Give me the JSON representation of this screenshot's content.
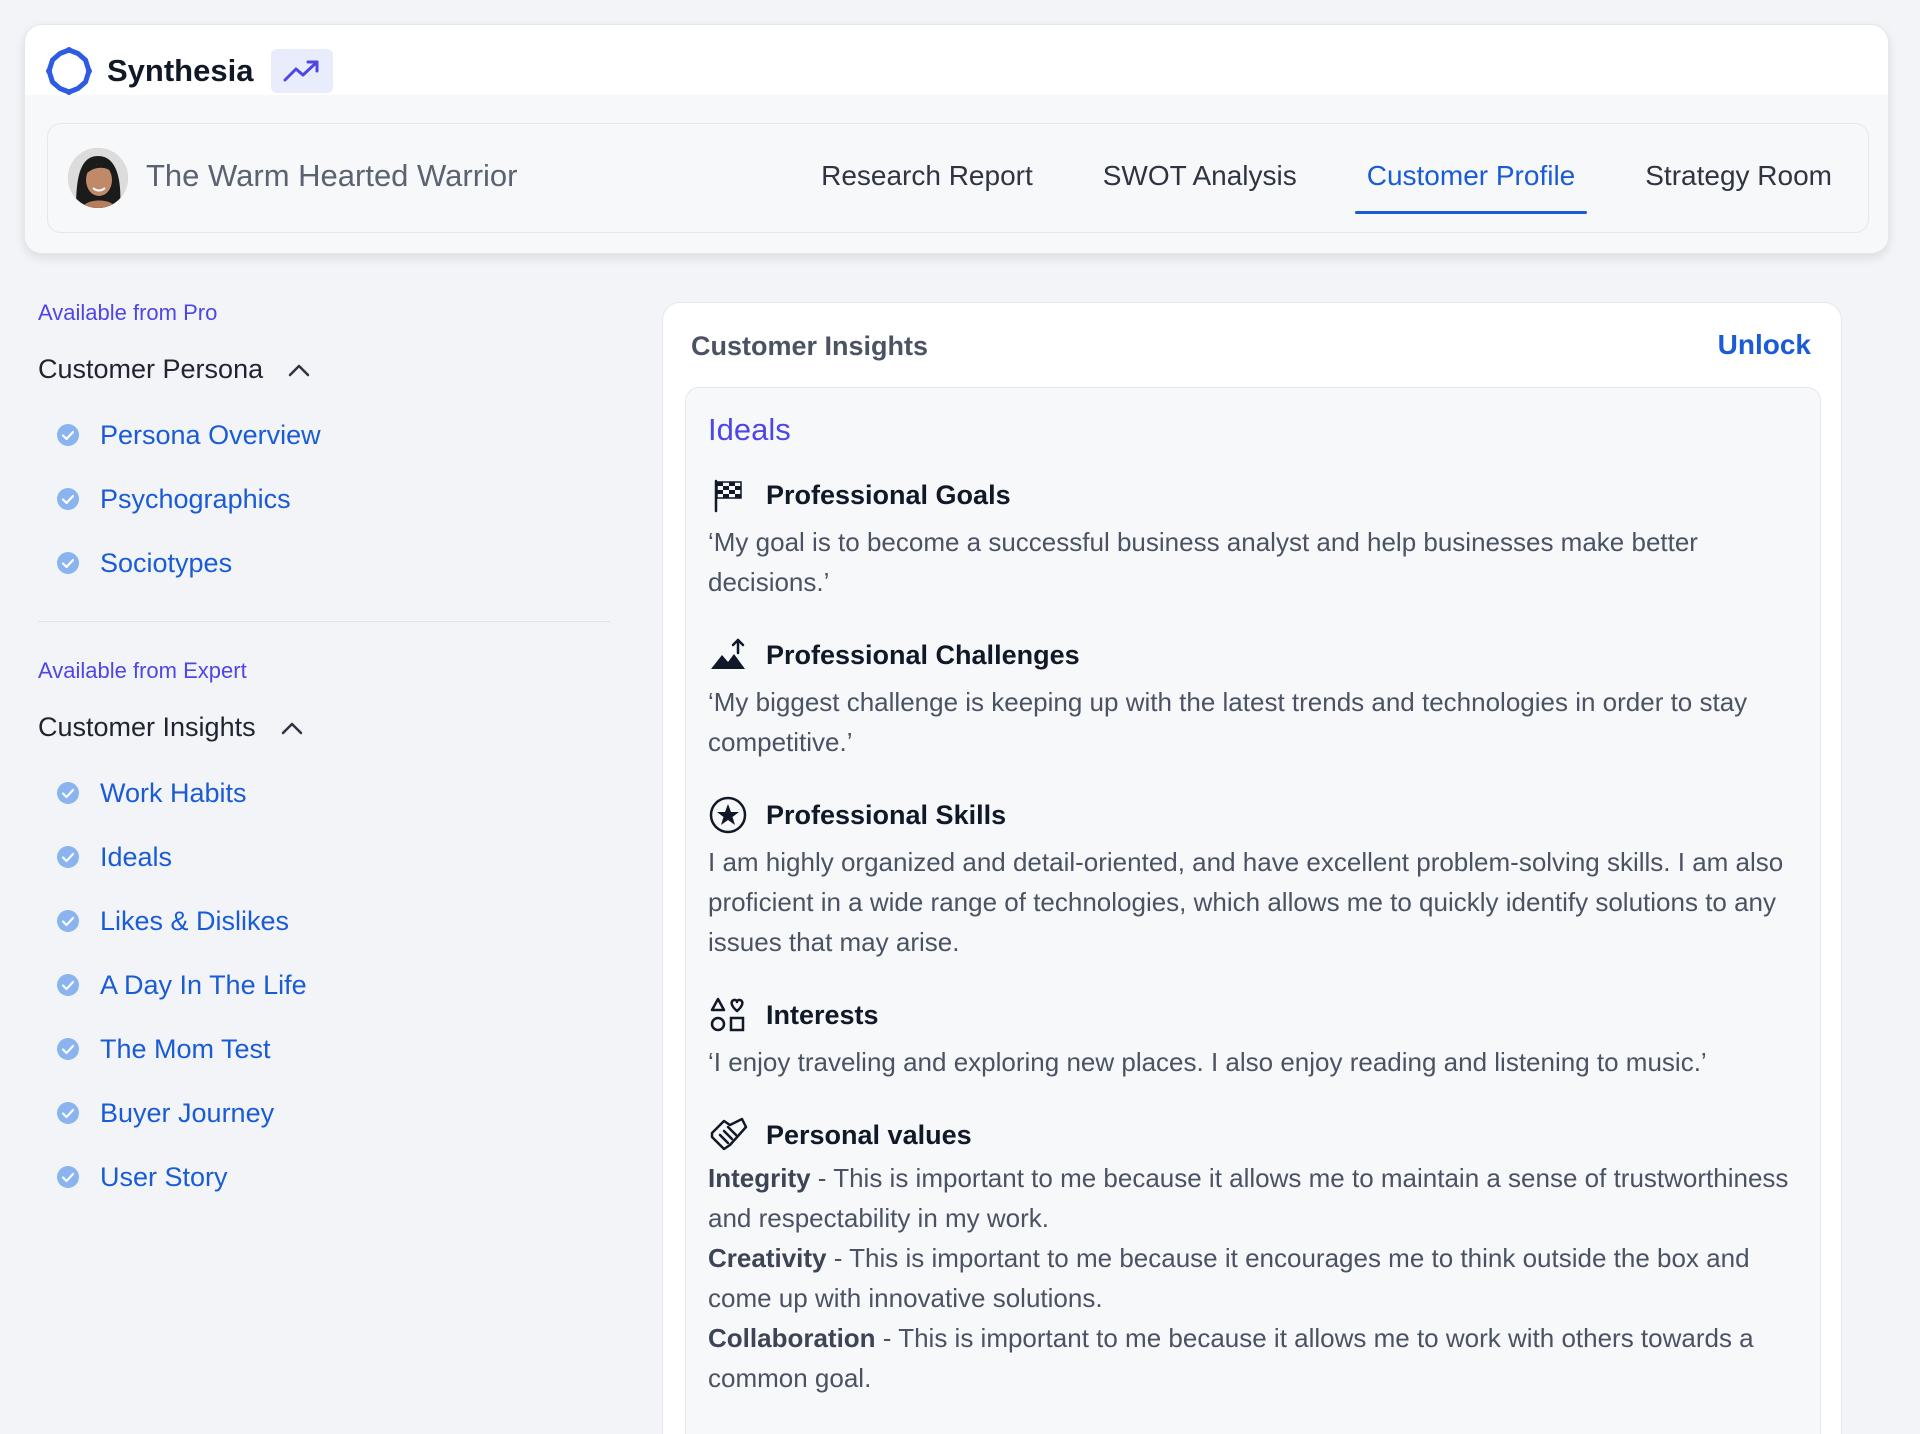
{
  "app": {
    "brand_name": "Synthesia",
    "logo_icon": "synthesia-ring-logo",
    "trend_icon": "trending-up-icon"
  },
  "persona": {
    "name": "The Warm Hearted Warrior",
    "avatar_icon": "avatar"
  },
  "tabs": [
    {
      "label": "Research Report",
      "active": false
    },
    {
      "label": "SWOT Analysis",
      "active": false
    },
    {
      "label": "Customer Profile",
      "active": true
    },
    {
      "label": "Strategy Room",
      "active": false
    }
  ],
  "sidebar": {
    "sections": [
      {
        "availability": "Available from Pro",
        "title": "Customer Persona",
        "items": [
          "Persona Overview",
          "Psychographics",
          "Sociotypes"
        ]
      },
      {
        "availability": "Available from Expert",
        "title": "Customer Insights",
        "items": [
          "Work Habits",
          "Ideals",
          "Likes & Dislikes",
          "A Day In The Life",
          "The Mom Test",
          "Buyer Journey",
          "User Story"
        ]
      }
    ]
  },
  "panel": {
    "title": "Customer Insights",
    "unlock_label": "Unlock",
    "section_title": "Ideals",
    "blocks": [
      {
        "icon": "checkered-flag-icon",
        "title": "Professional Goals",
        "text": "‘My goal is to become a successful business analyst and help businesses make better decisions.’"
      },
      {
        "icon": "mountain-arrow-icon",
        "title": "Professional Challenges",
        "text": "‘My biggest challenge is keeping up with the latest trends and technologies in order to stay competitive.’"
      },
      {
        "icon": "star-circle-icon",
        "title": "Professional Skills",
        "text": "I am highly organized and detail-oriented, and have excellent problem-solving skills. I am also proficient in a wide range of technologies, which allows me to quickly identify solutions to any issues that may arise."
      },
      {
        "icon": "shapes-icon",
        "title": "Interests",
        "text": "‘I enjoy traveling and exploring new places. I also enjoy reading and listening to music.’"
      }
    ],
    "values_block": {
      "icon": "handshake-icon",
      "title": "Personal values",
      "items": [
        {
          "name": "Integrity",
          "text": " - This is important to me because it allows me to maintain a sense of trustworthiness and respectability in my work."
        },
        {
          "name": "Creativity",
          "text": " - This is important to me because it encourages me to think outside the box and come up with innovative solutions."
        },
        {
          "name": "Collaboration",
          "text": " - This is important to me because it allows me to work with others towards a common goal."
        }
      ]
    }
  },
  "colors": {
    "accent": "#1a5bd6",
    "indigo": "#4f46e5",
    "check_fill": "#8ab4f0"
  }
}
